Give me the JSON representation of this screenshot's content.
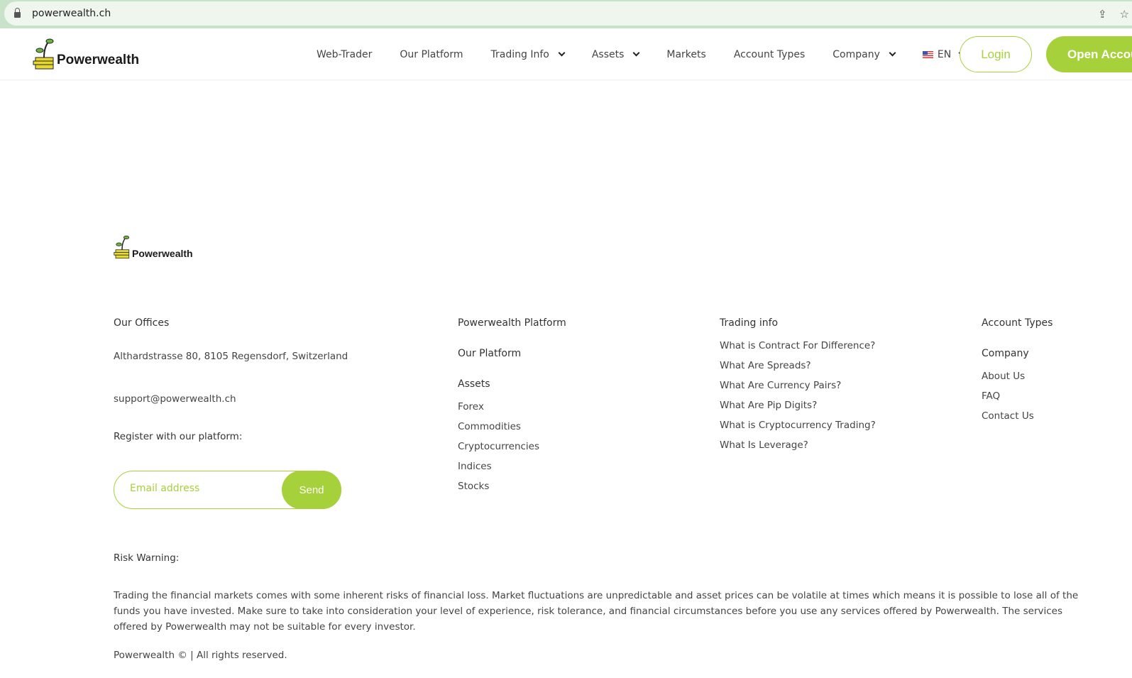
{
  "browser": {
    "url": "powerwealth.ch"
  },
  "header": {
    "brand": "Powerwealth",
    "menu": [
      {
        "label": "Web-Trader"
      },
      {
        "label": "Our Platform"
      },
      {
        "label": "Trading Info"
      },
      {
        "label": "Assets"
      },
      {
        "label": "Markets"
      },
      {
        "label": "Account Types"
      },
      {
        "label": "Company"
      },
      {
        "label": "EN"
      }
    ],
    "login": "Login",
    "open_account": "Open Account"
  },
  "footer": {
    "brand": "Powerwealth",
    "offices": {
      "title": "Our Offices",
      "address": "Althardstrasse 80, 8105 Regensdorf, Switzerland",
      "email": "support@powerwealth.ch",
      "register": "Register with our platform:",
      "email_placeholder": "Email address",
      "send": "Send"
    },
    "platform": {
      "title": "Powerwealth Platform",
      "our_platform": "Our Platform",
      "assets": "Assets",
      "items": [
        "Forex",
        "Commodities",
        "Cryptocurrencies",
        "Indices",
        "Stocks"
      ]
    },
    "trading": {
      "title": "Trading info",
      "items": [
        "What is Contract For Difference?",
        "What Are Spreads?",
        "What Are Currency Pairs?",
        "What Are Pip Digits?",
        "What is Cryptocurrency Trading?",
        "What Is Leverage?"
      ]
    },
    "accounts": {
      "title": "Account Types",
      "company": "Company",
      "items": [
        "About Us",
        "FAQ",
        "Contact Us"
      ]
    },
    "risk_title": "Risk Warning:",
    "risk_text": "Trading the financial markets comes with some inherent risks of financial loss. Market fluctuations are unpredictable and asset prices can be volatile at times which means it is possible to lose all of the funds you have invested. Make sure to take into consideration your level of experience, risk tolerance, and financial circumstances before you use any services offered by Powerwealth. The services offered by Powerwealth may not be suitable for every investor.",
    "copyright": "Powerwealth © | All rights reserved."
  },
  "colors": {
    "accent": "#a6d13a"
  }
}
